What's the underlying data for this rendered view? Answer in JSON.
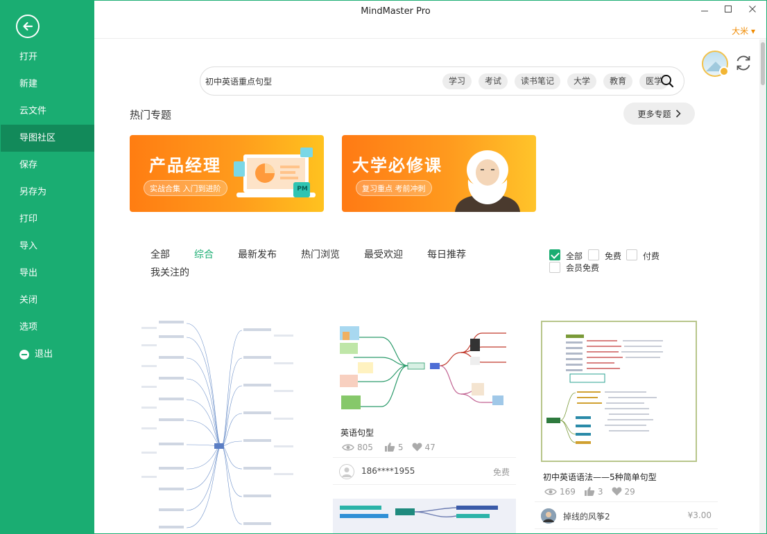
{
  "window": {
    "title": "MindMaster Pro",
    "user_name": "大米 ▾"
  },
  "sidebar": {
    "items": [
      {
        "label": "打开",
        "active": false
      },
      {
        "label": "新建",
        "active": false
      },
      {
        "label": "云文件",
        "active": false
      },
      {
        "label": "导图社区",
        "active": true
      },
      {
        "label": "保存",
        "active": false
      },
      {
        "label": "另存为",
        "active": false
      },
      {
        "label": "打印",
        "active": false
      },
      {
        "label": "导入",
        "active": false
      },
      {
        "label": "导出",
        "active": false
      },
      {
        "label": "关闭",
        "active": false
      },
      {
        "label": "选项",
        "active": false
      },
      {
        "label": "退出",
        "active": false
      }
    ]
  },
  "search": {
    "value": "初中英语重点句型",
    "tags": [
      "学习",
      "考试",
      "读书笔记",
      "大学",
      "教育",
      "医学"
    ]
  },
  "hot_topics": {
    "title": "热门专题",
    "more_label": "更多专题",
    "banners": [
      {
        "title": "产品经理",
        "subtitle": "实战合集 入门到进阶",
        "badge": "PM"
      },
      {
        "title": "大学必修课",
        "subtitle": "复习重点 考前冲刺"
      }
    ]
  },
  "filters": {
    "tabs": [
      "全部",
      "综合",
      "最新发布",
      "热门浏览",
      "最受欢迎",
      "每日推荐",
      "我关注的"
    ],
    "active_tab": "综合",
    "price_filters": [
      {
        "label": "全部",
        "checked": true
      },
      {
        "label": "免费",
        "checked": false
      },
      {
        "label": "付费",
        "checked": false
      },
      {
        "label": "会员免费",
        "checked": false
      }
    ]
  },
  "cards": [
    {
      "title": "英语句型",
      "views": "805",
      "likes": "5",
      "favorites": "47",
      "author": "186****1955",
      "price": "免费"
    },
    {
      "title": "初中英语语法——5种简单句型",
      "views": "169",
      "likes": "3",
      "favorites": "29",
      "author": "掉线的风筝2",
      "price": "¥3.00"
    }
  ],
  "colors": {
    "accent": "#1aad72",
    "accent_dark": "#128a5a",
    "user_name": "#f08a00",
    "banner_orange": "#ff8a18"
  }
}
